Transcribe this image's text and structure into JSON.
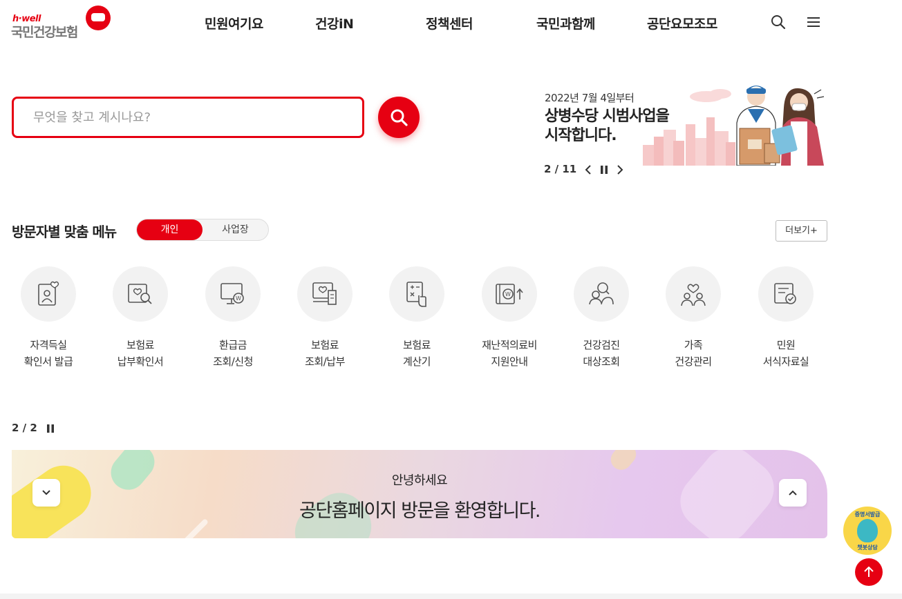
{
  "header": {
    "logo_small": "h·well",
    "logo_main": "국민건강보험",
    "nav": [
      "민원여기요",
      "건강iN",
      "정책센터",
      "국민과함께",
      "공단요모조모"
    ],
    "search_icon": "search-icon",
    "menu_icon": "hamburger-menu-icon"
  },
  "search": {
    "placeholder": "무엇을 찾고 계시나요?",
    "value": ""
  },
  "banner": {
    "date": "2022년 7월 4일부터",
    "title_line1": "상병수당 시범사업을",
    "title_line2": "시작합니다.",
    "pager": "2 / 11"
  },
  "visitor_menu": {
    "title": "방문자별 맞춤 메뉴",
    "toggle": [
      "개인",
      "사업장"
    ],
    "selected": "개인",
    "more": "더보기+",
    "items": [
      {
        "line1": "자격득실",
        "line2": "확인서 발급",
        "icon": "id-card-heart-icon"
      },
      {
        "line1": "보험료",
        "line2": "납부확인서",
        "icon": "document-search-icon"
      },
      {
        "line1": "환급금",
        "line2": "조회/신청",
        "icon": "monitor-won-icon"
      },
      {
        "line1": "보험료",
        "line2": "조회/납부",
        "icon": "monitor-receipt-icon"
      },
      {
        "line1": "보험료",
        "line2": "계산기",
        "icon": "calculator-icon"
      },
      {
        "line1": "재난적의료비",
        "line2": "지원안내",
        "icon": "won-support-icon"
      },
      {
        "line1": "건강검진",
        "line2": "대상조회",
        "icon": "people-search-icon"
      },
      {
        "line1": "가족",
        "line2": "건강관리",
        "icon": "family-heart-icon"
      },
      {
        "line1": "민원",
        "line2": "서식자료실",
        "icon": "form-check-icon"
      }
    ],
    "pager": "2 / 2"
  },
  "welcome": {
    "sub": "안녕하세요",
    "main": "공단홈페이지 방문을 환영합니다."
  },
  "floating": {
    "chatbot_top": "증명서발급",
    "chatbot_bottom": "챗봇상담"
  },
  "colors": {
    "accent": "#e60012",
    "icon_stroke": "#555555"
  }
}
